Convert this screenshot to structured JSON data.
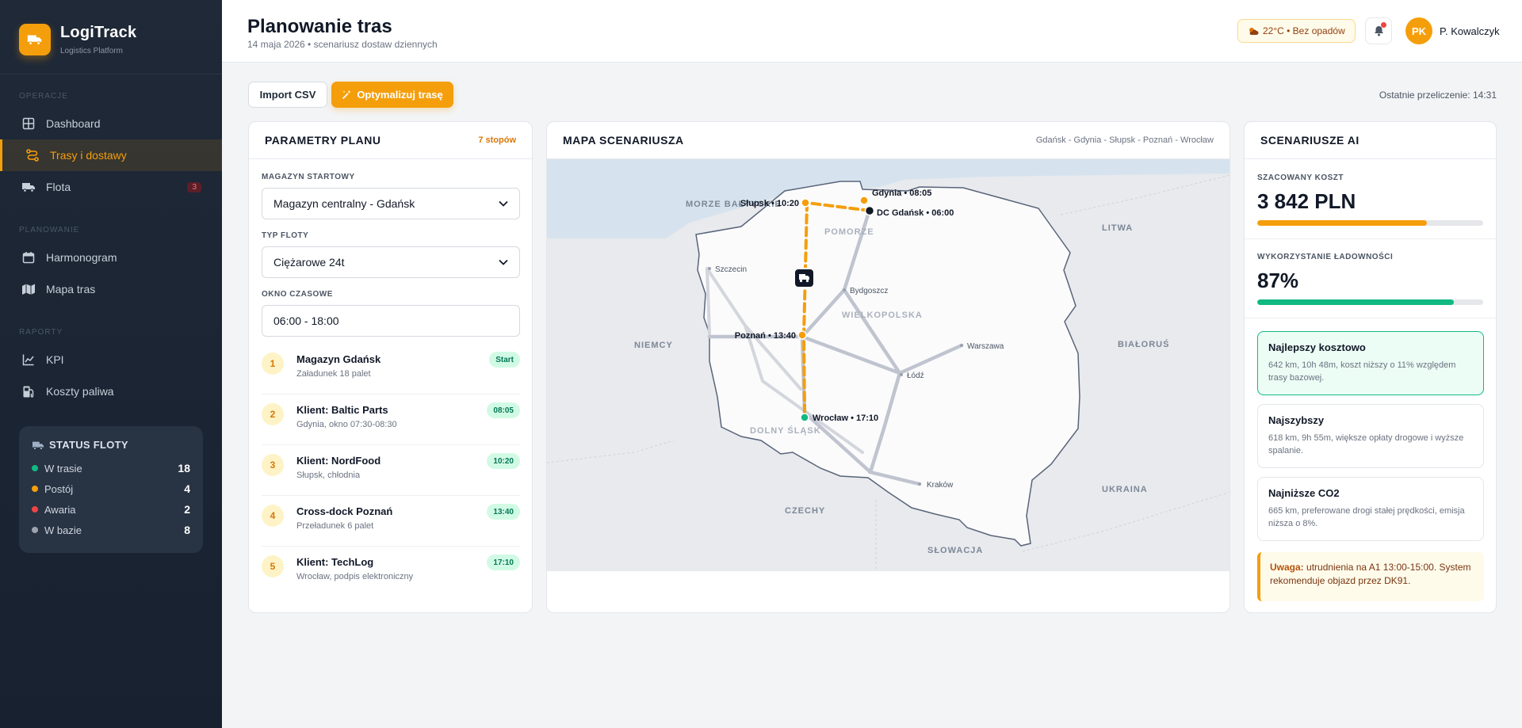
{
  "app": {
    "name": "LogiTrack",
    "subtitle": "Logistics Platform"
  },
  "sidebar": {
    "sections": {
      "operacje": "OPERACJE",
      "planowanie": "PLANOWANIE",
      "raporty": "RAPORTY"
    },
    "items": [
      {
        "label": "Dashboard",
        "icon": "dashboard-icon"
      },
      {
        "label": "Trasy i dostawy",
        "icon": "route-icon",
        "active": true
      },
      {
        "label": "Flota",
        "icon": "truck-icon",
        "badge": "3"
      },
      {
        "label": "Harmonogram",
        "icon": "calendar-icon"
      },
      {
        "label": "Mapa tras",
        "icon": "map-icon"
      },
      {
        "label": "KPI",
        "icon": "chart-line-icon"
      },
      {
        "label": "Koszty paliwa",
        "icon": "fuel-icon"
      }
    ],
    "fleet_status": {
      "title": "STATUS FLOTY",
      "rows": [
        {
          "label": "W trasie",
          "value": "18",
          "color": "#10b981"
        },
        {
          "label": "Postój",
          "value": "4",
          "color": "#f59e0b"
        },
        {
          "label": "Awaria",
          "value": "2",
          "color": "#ef4444"
        },
        {
          "label": "W bazie",
          "value": "8",
          "color": "#9ca3af"
        }
      ]
    }
  },
  "header": {
    "title": "Planowanie tras",
    "subtitle": "14 maja 2026 • scenariusz dostaw dziennych",
    "weather": "22°C • Bez opadów",
    "user_initials": "PK",
    "user_name": "P. Kowalczyk"
  },
  "toolbar": {
    "import_label": "Import CSV",
    "optimize_label": "Optymalizuj trasę",
    "last_recalc": "Ostatnie przeliczenie: 14:31"
  },
  "plan": {
    "title": "PARAMETRY PLANU",
    "stops_count": "7 stopów",
    "warehouse_label": "MAGAZYN STARTOWY",
    "warehouse_value": "Magazyn centralny - Gdańsk",
    "fleet_label": "TYP FLOTY",
    "fleet_value": "Ciężarowe 24t",
    "window_label": "OKNO CZASOWE",
    "window_value": "06:00 - 18:00",
    "stops": [
      {
        "num": "1",
        "title": "Magazyn Gdańsk",
        "sub": "Załadunek 18 palet",
        "tag": "Start"
      },
      {
        "num": "2",
        "title": "Klient: Baltic Parts",
        "sub": "Gdynia, okno 07:30-08:30",
        "tag": "08:05"
      },
      {
        "num": "3",
        "title": "Klient: NordFood",
        "sub": "Słupsk, chłodnia",
        "tag": "10:20"
      },
      {
        "num": "4",
        "title": "Cross-dock Poznań",
        "sub": "Przeładunek 6 palet",
        "tag": "13:40"
      },
      {
        "num": "5",
        "title": "Klient: TechLog",
        "sub": "Wrocław, podpis elektroniczny",
        "tag": "17:10"
      }
    ]
  },
  "map": {
    "title": "MAPA SCENARIUSZA",
    "route_summary": "Gdańsk - Gdynia - Słupsk - Poznań - Wrocław",
    "labels": {
      "sea": "MORZE BAŁTYCKIE",
      "pomorze": "POMORZE",
      "wielkopolska": "WIELKOPOLSKA",
      "dolny_slask": "DOLNY ŚLĄSK",
      "litwa": "LITWA",
      "bialorus": "BIAŁORUŚ",
      "ukraina": "UKRAINA",
      "niemcy": "NIEMCY",
      "czechy": "CZECHY",
      "slowacja": "SŁOWACJA"
    },
    "cities": {
      "szczecin": "Szczecin",
      "bydgoszcz": "Bydgoszcz",
      "warszawa": "Warszawa",
      "lodz": "Łódź",
      "krakow": "Kraków"
    },
    "route_labels": {
      "gdynia": "Gdynia • 08:05",
      "gdansk": "DC Gdańsk • 06:00",
      "slupsk": "Słupsk • 10:20",
      "poznan": "Poznań • 13:40",
      "wroclaw": "Wrocław • 17:10"
    }
  },
  "ai": {
    "title": "SCENARIUSZE AI",
    "cost_label": "SZACOWANY KOSZT",
    "cost_value": "3 842 PLN",
    "cost_fill": 0.75,
    "load_label": "WYKORZYSTANIE ŁADOWNOŚCI",
    "load_value": "87%",
    "load_fill": 0.87,
    "scenarios": [
      {
        "title": "Najlepszy kosztowo",
        "desc": "642 km, 10h 48m, koszt niższy o 11% względem trasy bazowej."
      },
      {
        "title": "Najszybszy",
        "desc": "618 km, 9h 55m, większe opłaty drogowe i wyższe spalanie."
      },
      {
        "title": "Najniższe CO2",
        "desc": "665 km, preferowane drogi stałej prędkości, emisja niższa o 8%."
      }
    ],
    "alert_bold": "Uwaga:",
    "alert_text": " utrudnienia na A1 13:00-15:00. System rekomenduje objazd przez DK91."
  },
  "colors": {
    "accent": "#f59e0b",
    "success": "#10b981",
    "sidebar_bg": "#1f2937"
  }
}
